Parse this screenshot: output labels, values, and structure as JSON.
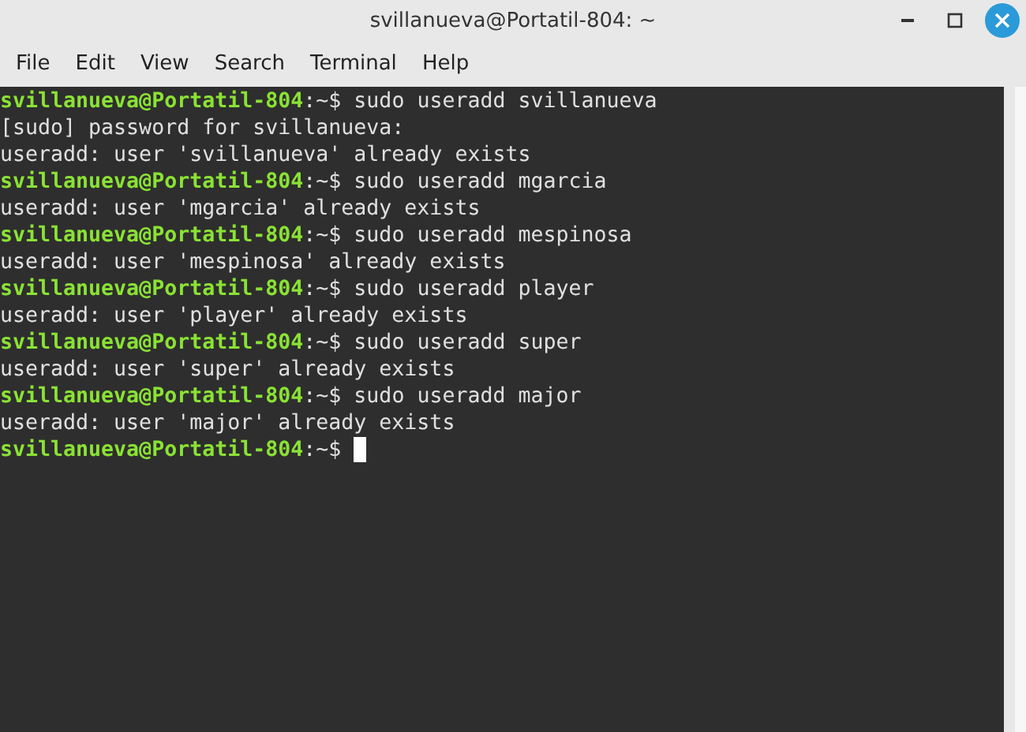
{
  "window": {
    "title": "svillanueva@Portatil-804: ~"
  },
  "menu": [
    "File",
    "Edit",
    "View",
    "Search",
    "Terminal",
    "Help"
  ],
  "terminal": {
    "lines": [
      {
        "kind": "prompt",
        "user_host": "svillanueva@Portatil-804",
        "path": ":~$",
        "command": "sudo useradd svillanueva",
        "cursor": false
      },
      {
        "kind": "output",
        "text": "[sudo] password for svillanueva:"
      },
      {
        "kind": "output",
        "text": "useradd: user 'svillanueva' already exists"
      },
      {
        "kind": "prompt",
        "user_host": "svillanueva@Portatil-804",
        "path": ":~$",
        "command": "sudo useradd mgarcia",
        "cursor": false
      },
      {
        "kind": "output",
        "text": "useradd: user 'mgarcia' already exists"
      },
      {
        "kind": "prompt",
        "user_host": "svillanueva@Portatil-804",
        "path": ":~$",
        "command": "sudo useradd mespinosa",
        "cursor": false
      },
      {
        "kind": "output",
        "text": "useradd: user 'mespinosa' already exists"
      },
      {
        "kind": "prompt",
        "user_host": "svillanueva@Portatil-804",
        "path": ":~$",
        "command": "sudo useradd player",
        "cursor": false
      },
      {
        "kind": "output",
        "text": "useradd: user 'player' already exists"
      },
      {
        "kind": "prompt",
        "user_host": "svillanueva@Portatil-804",
        "path": ":~$",
        "command": "sudo useradd super",
        "cursor": false
      },
      {
        "kind": "output",
        "text": "useradd: user 'super' already exists"
      },
      {
        "kind": "prompt",
        "user_host": "svillanueva@Portatil-804",
        "path": ":~$",
        "command": "sudo useradd major",
        "cursor": false
      },
      {
        "kind": "output",
        "text": "useradd: user 'major' already exists"
      },
      {
        "kind": "prompt",
        "user_host": "svillanueva@Portatil-804",
        "path": ":~$",
        "cursor": true
      }
    ]
  }
}
